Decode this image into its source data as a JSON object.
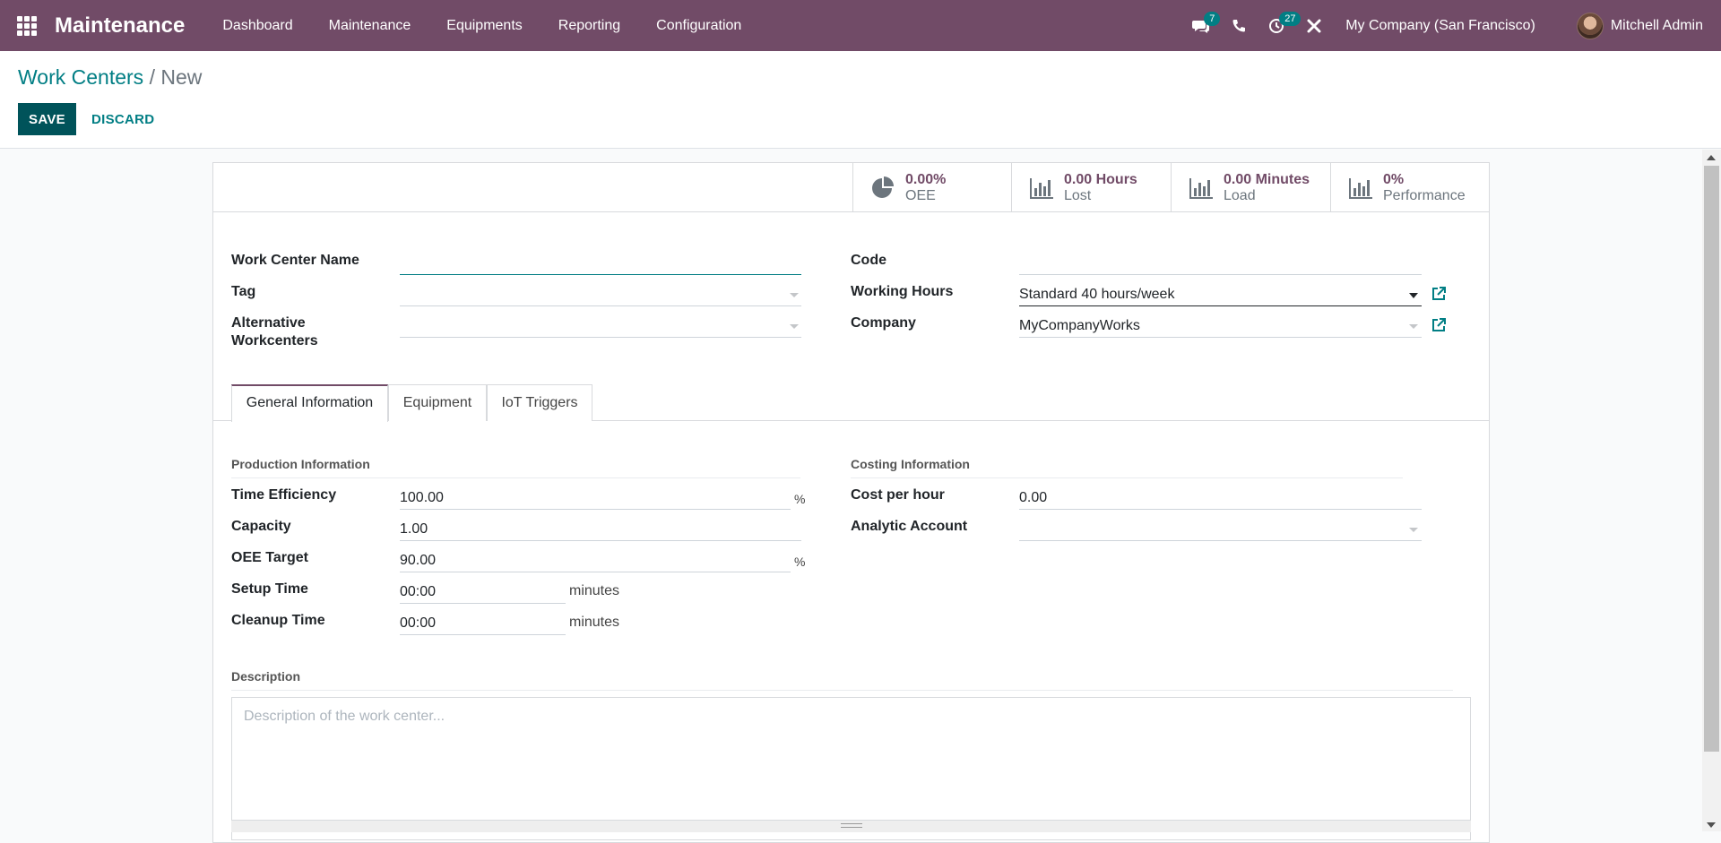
{
  "navbar": {
    "app_name": "Maintenance",
    "menu": [
      "Dashboard",
      "Maintenance",
      "Equipments",
      "Reporting",
      "Configuration"
    ],
    "discuss_badge": "7",
    "activity_badge": "27",
    "company": "My Company (San Francisco)",
    "user": "Mitchell Admin"
  },
  "breadcrumb": {
    "parent": "Work Centers",
    "separator": "/",
    "current": "New"
  },
  "actions": {
    "save_label": "SAVE",
    "discard_label": "DISCARD"
  },
  "smart_buttons": [
    {
      "value": "0.00%",
      "label": "OEE",
      "icon": "pie-chart-icon"
    },
    {
      "value": "0.00 Hours",
      "label": "Lost",
      "icon": "bar-chart-icon"
    },
    {
      "value": "0.00 Minutes",
      "label": "Load",
      "icon": "bar-chart-icon"
    },
    {
      "value": "0%",
      "label": "Performance",
      "icon": "bar-chart-icon"
    }
  ],
  "header_fields": {
    "work_center_name": {
      "label": "Work Center Name",
      "value": ""
    },
    "tag": {
      "label": "Tag",
      "value": ""
    },
    "alternative_workcenters": {
      "label": "Alternative Workcenters",
      "value": ""
    },
    "code": {
      "label": "Code",
      "value": ""
    },
    "working_hours": {
      "label": "Working Hours",
      "value": "Standard 40 hours/week"
    },
    "company": {
      "label": "Company",
      "value": "MyCompanyWorks"
    }
  },
  "tabs": [
    "General Information",
    "Equipment",
    "IoT Triggers"
  ],
  "production": {
    "title": "Production Information",
    "time_efficiency": {
      "label": "Time Efficiency",
      "value": "100.00",
      "unit": "%"
    },
    "capacity": {
      "label": "Capacity",
      "value": "1.00"
    },
    "oee_target": {
      "label": "OEE Target",
      "value": "90.00",
      "unit": "%"
    },
    "setup_time": {
      "label": "Setup Time",
      "value": "00:00",
      "unit": "minutes"
    },
    "cleanup_time": {
      "label": "Cleanup Time",
      "value": "00:00",
      "unit": "minutes"
    }
  },
  "costing": {
    "title": "Costing Information",
    "cost_per_hour": {
      "label": "Cost per hour",
      "value": "0.00"
    },
    "analytic_account": {
      "label": "Analytic Account",
      "value": ""
    }
  },
  "description": {
    "title": "Description",
    "placeholder": "Description of the work center..."
  },
  "colors": {
    "brand": "#714b67",
    "primary": "#00535a",
    "link": "#017e84"
  }
}
